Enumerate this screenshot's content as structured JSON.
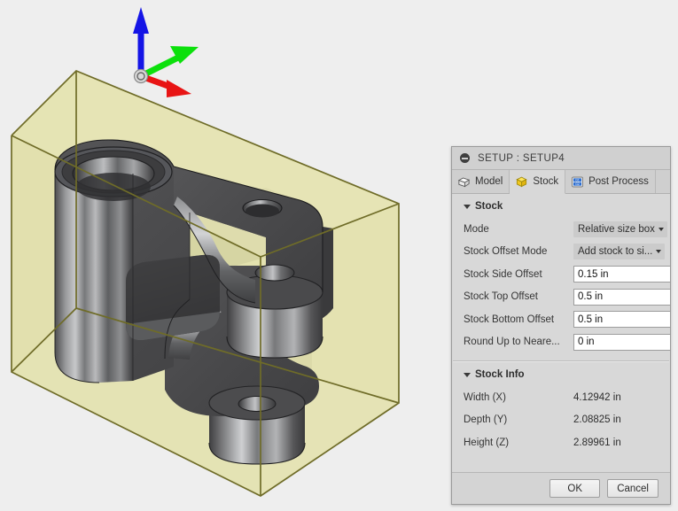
{
  "viewport": {
    "background_color": "#eeeeee",
    "stock_fill": "#e3e1ad",
    "stock_edge": "#6f6c28",
    "model_color": "#4a4a4a",
    "triad": {
      "origin_label": "origin-marker",
      "axes": [
        {
          "name": "z-axis",
          "color": "#1414e6",
          "direction": "up"
        },
        {
          "name": "y-axis",
          "color": "#0ce00c",
          "direction": "upper-right"
        },
        {
          "name": "x-axis",
          "color": "#e81414",
          "direction": "lower-right"
        }
      ]
    }
  },
  "dialog": {
    "title": "SETUP : SETUP4",
    "collapse_icon": "collapse-icon",
    "tabs": [
      {
        "label": "Model",
        "icon": "model-cube-icon",
        "active": false
      },
      {
        "label": "Stock",
        "icon": "stock-cube-icon",
        "active": true
      },
      {
        "label": "Post Process",
        "icon": "gcode-icon",
        "active": false
      }
    ],
    "stock_section": {
      "title": "Stock",
      "rows": [
        {
          "label": "Mode",
          "type": "select",
          "value": "Relative size box"
        },
        {
          "label": "Stock Offset Mode",
          "type": "select",
          "value": "Add stock to si..."
        },
        {
          "label": "Stock Side Offset",
          "type": "spin",
          "value": "0.15 in"
        },
        {
          "label": "Stock Top Offset",
          "type": "spin",
          "value": "0.5 in"
        },
        {
          "label": "Stock Bottom Offset",
          "type": "spin",
          "value": "0.5 in"
        },
        {
          "label": "Round Up to Neare...",
          "type": "spin",
          "value": "0 in"
        }
      ]
    },
    "stock_info": {
      "title": "Stock Info",
      "rows": [
        {
          "label": "Width (X)",
          "value": "4.12942 in"
        },
        {
          "label": "Depth (Y)",
          "value": "2.08825 in"
        },
        {
          "label": "Height (Z)",
          "value": "2.89961 in"
        }
      ]
    },
    "footer": {
      "ok_label": "OK",
      "cancel_label": "Cancel"
    }
  }
}
